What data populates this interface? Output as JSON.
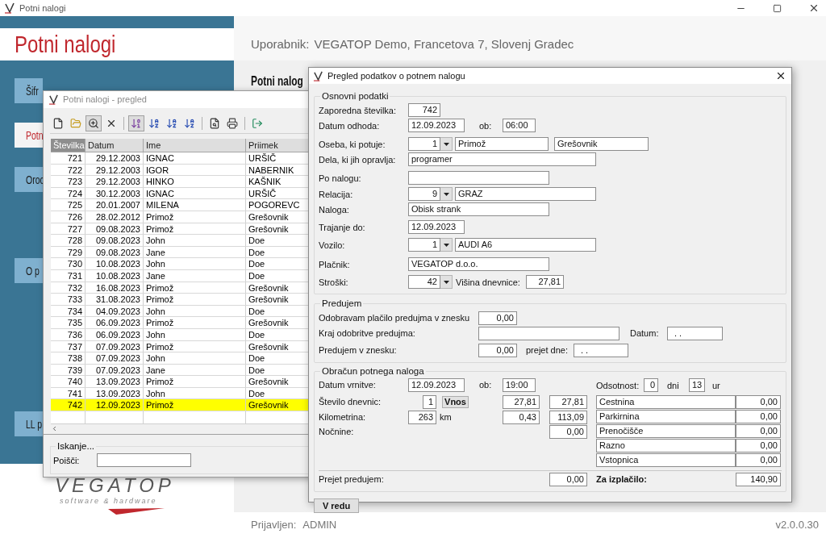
{
  "app": {
    "title": "Potni nalogi",
    "heading": "Potni nalogi",
    "user_label": "Uporabnik:",
    "user": "VEGATOP Demo, Francetova 7, Slovenj Gradec",
    "page_heading": "Potni nalog",
    "menu": [
      {
        "label": "Šifr",
        "selected": false
      },
      {
        "label": "Potn",
        "selected": true
      },
      {
        "label": "Oroc",
        "selected": false
      },
      {
        "label": "O p",
        "selected": false
      },
      {
        "label": "LL p",
        "selected": false
      }
    ],
    "logo": {
      "name": "VEGATOP",
      "tagline": "software & hardware"
    },
    "footer": {
      "login_label": "Prijavljen:",
      "login": "ADMIN",
      "version": "v2.0.0.30"
    }
  },
  "list_window": {
    "title": "Potni nalogi - pregled",
    "toolbar": [
      {
        "pressed": false
      },
      {
        "pressed": false
      },
      {
        "pressed": true
      },
      {
        "pressed": false
      },
      {
        "pressed": true
      },
      {
        "pressed": false
      },
      {
        "pressed": false
      },
      {
        "pressed": false
      },
      {
        "pressed": false
      },
      {
        "pressed": false
      },
      {
        "pressed": false
      }
    ],
    "columns": [
      {
        "label": "Številka",
        "sorted": true
      },
      {
        "label": "Datum",
        "sorted": false
      },
      {
        "label": "Ime",
        "sorted": false
      },
      {
        "label": "Priimek",
        "sorted": false
      }
    ],
    "rows": [
      {
        "cells": [
          "721",
          "29.12.2003",
          "IGNAC",
          "URŠIČ"
        ],
        "selected": false
      },
      {
        "cells": [
          "722",
          "29.12.2003",
          "IGOR",
          "NABERNIK"
        ],
        "selected": false
      },
      {
        "cells": [
          "723",
          "29.12.2003",
          "HINKO",
          "KAŠNIK"
        ],
        "selected": false
      },
      {
        "cells": [
          "724",
          "30.12.2003",
          "IGNAC",
          "URŠIČ"
        ],
        "selected": false
      },
      {
        "cells": [
          "725",
          "20.01.2007",
          "MILENA",
          "POGOREVC"
        ],
        "selected": false
      },
      {
        "cells": [
          "726",
          "28.02.2012",
          "Primož",
          "Grešovnik"
        ],
        "selected": false
      },
      {
        "cells": [
          "727",
          "09.08.2023",
          "Primož",
          "Grešovnik"
        ],
        "selected": false
      },
      {
        "cells": [
          "728",
          "09.08.2023",
          "John",
          "Doe"
        ],
        "selected": false
      },
      {
        "cells": [
          "729",
          "09.08.2023",
          "Jane",
          "Doe"
        ],
        "selected": false
      },
      {
        "cells": [
          "730",
          "10.08.2023",
          "John",
          "Doe"
        ],
        "selected": false
      },
      {
        "cells": [
          "731",
          "10.08.2023",
          "Jane",
          "Doe"
        ],
        "selected": false
      },
      {
        "cells": [
          "732",
          "16.08.2023",
          "Primož",
          "Grešovnik"
        ],
        "selected": false
      },
      {
        "cells": [
          "733",
          "31.08.2023",
          "Primož",
          "Grešovnik"
        ],
        "selected": false
      },
      {
        "cells": [
          "734",
          "04.09.2023",
          "John",
          "Doe"
        ],
        "selected": false
      },
      {
        "cells": [
          "735",
          "06.09.2023",
          "Primož",
          "Grešovnik"
        ],
        "selected": false
      },
      {
        "cells": [
          "736",
          "06.09.2023",
          "John",
          "Doe"
        ],
        "selected": false
      },
      {
        "cells": [
          "737",
          "07.09.2023",
          "Primož",
          "Grešovnik"
        ],
        "selected": false
      },
      {
        "cells": [
          "738",
          "07.09.2023",
          "John",
          "Doe"
        ],
        "selected": false
      },
      {
        "cells": [
          "739",
          "07.09.2023",
          "Jane",
          "Doe"
        ],
        "selected": false
      },
      {
        "cells": [
          "740",
          "13.09.2023",
          "Primož",
          "Grešovnik"
        ],
        "selected": false
      },
      {
        "cells": [
          "741",
          "13.09.2023",
          "John",
          "Doe"
        ],
        "selected": false
      },
      {
        "cells": [
          "742",
          "12.09.2023",
          "Primož",
          "Grešovnik"
        ],
        "selected": true
      }
    ],
    "search": {
      "legend": "Iskanje...",
      "label": "Poišči:"
    }
  },
  "dialog": {
    "title": "Pregled podatkov o potnem nalogu",
    "basic": {
      "legend": "Osnovni podatki",
      "number": {
        "label": "Zaporedna številka:",
        "value": "742"
      },
      "departure": {
        "label": "Datum odhoda:",
        "date": "12.09.2023",
        "time_label": "ob:",
        "time": "06:00"
      },
      "person": {
        "label": "Oseba, ki potuje:",
        "code": "1",
        "first_name": "Primož",
        "last_name": "Grešovnik"
      },
      "job": {
        "label": "Dela, ki jih opravlja:",
        "value": "programer"
      },
      "by_order": {
        "label": "Po nalogu:"
      },
      "route": {
        "label": "Relacija:",
        "code": "9",
        "value": "GRAZ"
      },
      "task": {
        "label": "Naloga:",
        "value": "Obisk strank"
      },
      "until": {
        "label": "Trajanje do:",
        "value": "12.09.2023"
      },
      "vehicle": {
        "label": "Vozilo:",
        "code": "1",
        "value": "AUDI A6"
      },
      "payer": {
        "label": "Plačnik:",
        "value": "VEGATOP d.o.o."
      },
      "costs": {
        "label": "Stroški:",
        "code": "42",
        "allowance_label": "Višina dnevnice:",
        "allowance": "27,81"
      }
    },
    "advance": {
      "legend": "Predujem",
      "approve": {
        "label": "Odobravam plačilo predujma v znesku",
        "value": "0,00"
      },
      "place": {
        "label": "Kraj odobritve predujma:",
        "date_label": "Datum:",
        "date": ". ."
      },
      "amount": {
        "label": "Predujem v znesku:",
        "value": "0,00",
        "received_label": "prejet dne:",
        "received": ". ."
      }
    },
    "settlement": {
      "legend": "Obračun potnega naloga",
      "return": {
        "label": "Datum vrnitve:",
        "date": "12.09.2023",
        "time_label": "ob:",
        "time": "19:00"
      },
      "absence": {
        "label": "Odsotnost:",
        "days": "0",
        "days_label": "dni",
        "hours": "13",
        "hours_label": "ur"
      },
      "allowances": {
        "label": "Število dnevnic:",
        "count": "1",
        "button": "Vnos",
        "rate": "27,81",
        "total": "27,81"
      },
      "mileage": {
        "label": "Kilometrina:",
        "km": "263",
        "unit": "km",
        "rate": "0,43",
        "total": "113,09"
      },
      "night": {
        "label": "Nočnine:",
        "total": "0,00"
      },
      "expenses": [
        {
          "name": "Cestnina",
          "value": "0,00"
        },
        {
          "name": "Parkirnina",
          "value": "0,00"
        },
        {
          "name": "Prenočišče",
          "value": "0,00"
        },
        {
          "name": "Razno",
          "value": "0,00"
        },
        {
          "name": "Vstopnica",
          "value": "0,00"
        }
      ],
      "advance_received": {
        "label": "Prejet predujem:",
        "value": "0,00"
      },
      "payout": {
        "label": "Za izplačilo:",
        "value": "140,90"
      }
    },
    "ok_button": "V redu"
  }
}
